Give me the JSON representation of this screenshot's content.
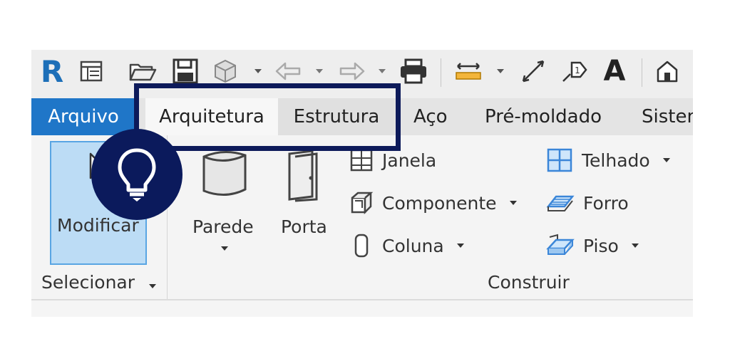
{
  "quick_access": {
    "icons": [
      "revit-logo-icon",
      "properties-icon",
      "open-folder-icon",
      "save-icon",
      "sync-icon",
      "undo-icon",
      "redo-icon",
      "print-icon",
      "measure-icon",
      "align-dimension-icon",
      "tag-icon",
      "text-icon",
      "3d-view-icon"
    ],
    "logo_letter": "R",
    "text_glyph": "A"
  },
  "tabs": [
    {
      "label": "Arquivo"
    },
    {
      "label": "Arquitetura"
    },
    {
      "label": "Estrutura"
    },
    {
      "label": "Aço"
    },
    {
      "label": "Pré-moldado"
    },
    {
      "label": "Sisten"
    }
  ],
  "ribbon": {
    "select_panel": {
      "button_label": "Modificar",
      "panel_label": "Selecionar"
    },
    "build_panel": {
      "panel_label": "Construir",
      "large_buttons": [
        {
          "label": "Parede"
        },
        {
          "label": "Porta"
        }
      ],
      "small_buttons": [
        {
          "label": "Janela",
          "icon": "window-icon"
        },
        {
          "label": "Componente",
          "icon": "component-icon"
        },
        {
          "label": "Coluna",
          "icon": "column-icon"
        },
        {
          "label": "Telhado",
          "icon": "roof-icon"
        },
        {
          "label": "Forro",
          "icon": "ceiling-icon"
        },
        {
          "label": "Piso",
          "icon": "floor-icon"
        }
      ]
    }
  },
  "overlay": {
    "tip_icon": "lightbulb-icon",
    "highlight_color": "#0d1a5a",
    "badge_color": "#0b1a5c"
  },
  "colors": {
    "file_tab": "#1f76c8",
    "modify_button": "#bcdcf5",
    "modify_border": "#59a5e3"
  }
}
